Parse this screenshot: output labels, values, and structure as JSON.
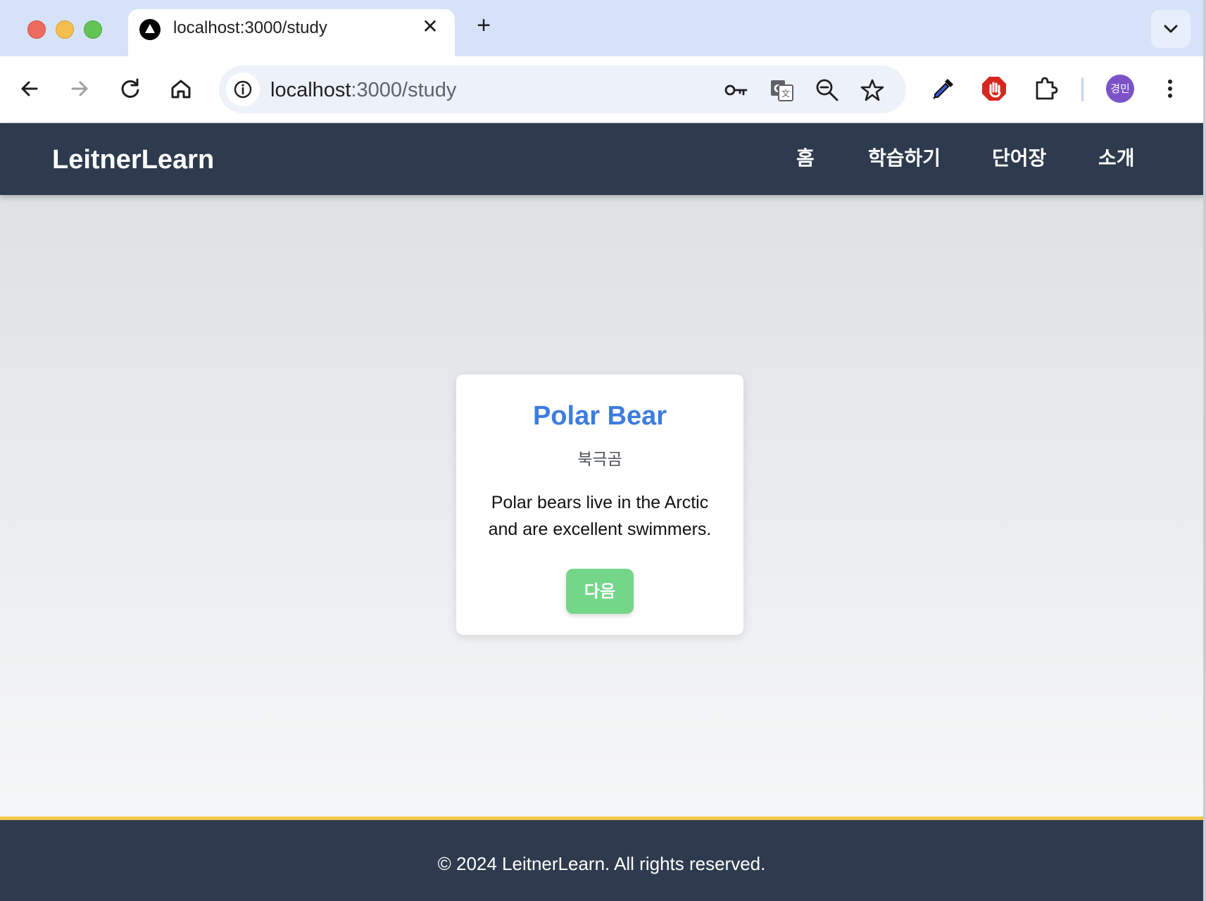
{
  "browser": {
    "tab_title": "localhost:3000/study",
    "tab_close": "✕",
    "new_tab": "+",
    "url_host": "localhost",
    "url_rest": ":3000/study",
    "profile_initials": "경민"
  },
  "icons": {
    "back": "back-arrow-icon",
    "forward": "forward-arrow-icon",
    "reload": "reload-icon",
    "home": "home-icon",
    "site_info": "info-icon",
    "password": "key-icon",
    "translate": "translate-icon",
    "zoom": "zoom-out-icon",
    "bookmark": "star-icon",
    "eyedropper": "eyedropper-icon",
    "adblock": "stop-hand-icon",
    "extensions": "puzzle-icon",
    "menu": "kebab-menu-icon"
  },
  "site": {
    "brand": "LeitnerLearn",
    "nav": [
      "홈",
      "학습하기",
      "단어장",
      "소개"
    ]
  },
  "card": {
    "word": "Polar Bear",
    "meaning": "북극곰",
    "example": "Polar bears live in the Arctic and are excellent swimmers.",
    "next_label": "다음"
  },
  "footer": {
    "text": "© 2024 LeitnerLearn. All rights reserved."
  },
  "colors": {
    "header_bg": "#2e3b4e",
    "footer_accent": "#f2c94c",
    "word_color": "#3d7ce0",
    "next_button": "#74d689",
    "avatar": "#7b52c8"
  }
}
